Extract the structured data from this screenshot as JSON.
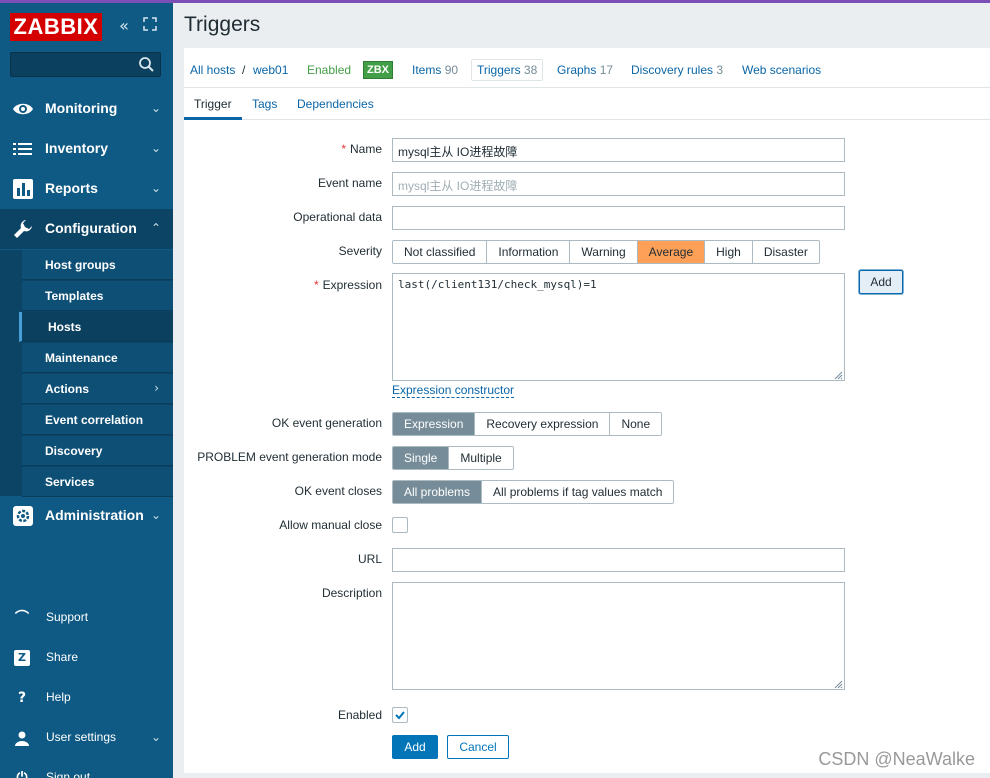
{
  "app": {
    "logo": "ZABBIX",
    "colors": {
      "sidebar": "#0f5a84",
      "brand_red": "#d40000",
      "link": "#0a66a8",
      "enabled_green": "#429e47",
      "severity_average": "#ffa059"
    }
  },
  "sidebar": {
    "controls": [
      "collapse-icon",
      "kiosk-icon"
    ],
    "search": {
      "placeholder": "",
      "icon": "search-icon"
    },
    "menu": [
      {
        "label": "Monitoring",
        "icon": "eye-icon",
        "chevron": "⌄"
      },
      {
        "label": "Inventory",
        "icon": "list-icon",
        "chevron": "⌄"
      },
      {
        "label": "Reports",
        "icon": "bar-chart-icon",
        "chevron": "⌄"
      },
      {
        "label": "Configuration",
        "icon": "wrench-icon",
        "chevron": "⌃"
      },
      {
        "label": "Administration",
        "icon": "gear-icon",
        "chevron": "⌄"
      }
    ],
    "submenu": [
      {
        "label": "Host groups"
      },
      {
        "label": "Templates"
      },
      {
        "label": "Hosts"
      },
      {
        "label": "Maintenance"
      },
      {
        "label": "Actions",
        "chevron": "›"
      },
      {
        "label": "Event correlation"
      },
      {
        "label": "Discovery"
      },
      {
        "label": "Services"
      }
    ],
    "bottom": [
      {
        "label": "Support",
        "icon": "headset-icon",
        "glyph": "⌒"
      },
      {
        "label": "Share",
        "icon": "share-z-icon",
        "glyph": "Z"
      },
      {
        "label": "Help",
        "icon": "help-icon",
        "glyph": "?"
      },
      {
        "label": "User settings",
        "icon": "user-icon",
        "chevron": "⌄"
      },
      {
        "label": "Sign out",
        "icon": "power-icon",
        "glyph": "⏻"
      }
    ]
  },
  "page": {
    "title": "Triggers"
  },
  "breadcrumbs": {
    "all_hosts": "All hosts",
    "sep": "/",
    "host": "web01",
    "status": "Enabled",
    "zbx": "ZBX",
    "items": {
      "label": "Items",
      "count": "90"
    },
    "triggers": {
      "label": "Triggers",
      "count": "38"
    },
    "graphs": {
      "label": "Graphs",
      "count": "17"
    },
    "discovery": {
      "label": "Discovery rules",
      "count": "3"
    },
    "web": {
      "label": "Web scenarios"
    }
  },
  "tabs": [
    "Trigger",
    "Tags",
    "Dependencies"
  ],
  "form": {
    "name": {
      "label": "Name",
      "required": "*",
      "value": "mysql主从 IO进程故障"
    },
    "event_name": {
      "label": "Event name",
      "placeholder": "mysql主从 IO进程故障"
    },
    "operational_data": {
      "label": "Operational data",
      "value": ""
    },
    "severity": {
      "label": "Severity",
      "options": [
        "Not classified",
        "Information",
        "Warning",
        "Average",
        "High",
        "Disaster"
      ],
      "selected": "Average"
    },
    "expression": {
      "label": "Expression",
      "required": "*",
      "value": "last(/client131/check_mysql)=1",
      "add_button": "Add",
      "constructor_link": "Expression constructor"
    },
    "ok_event_generation": {
      "label": "OK event generation",
      "options": [
        "Expression",
        "Recovery expression",
        "None"
      ],
      "selected": "Expression"
    },
    "problem_mode": {
      "label": "PROBLEM event generation mode",
      "options": [
        "Single",
        "Multiple"
      ],
      "selected": "Single"
    },
    "ok_event_closes": {
      "label": "OK event closes",
      "options": [
        "All problems",
        "All problems if tag values match"
      ],
      "selected": "All problems"
    },
    "allow_manual_close": {
      "label": "Allow manual close",
      "checked": false
    },
    "url": {
      "label": "URL",
      "value": ""
    },
    "description": {
      "label": "Description",
      "value": ""
    },
    "enabled": {
      "label": "Enabled",
      "checked": true
    },
    "submit": "Add",
    "cancel": "Cancel"
  },
  "watermark": "CSDN @NeaWalke"
}
